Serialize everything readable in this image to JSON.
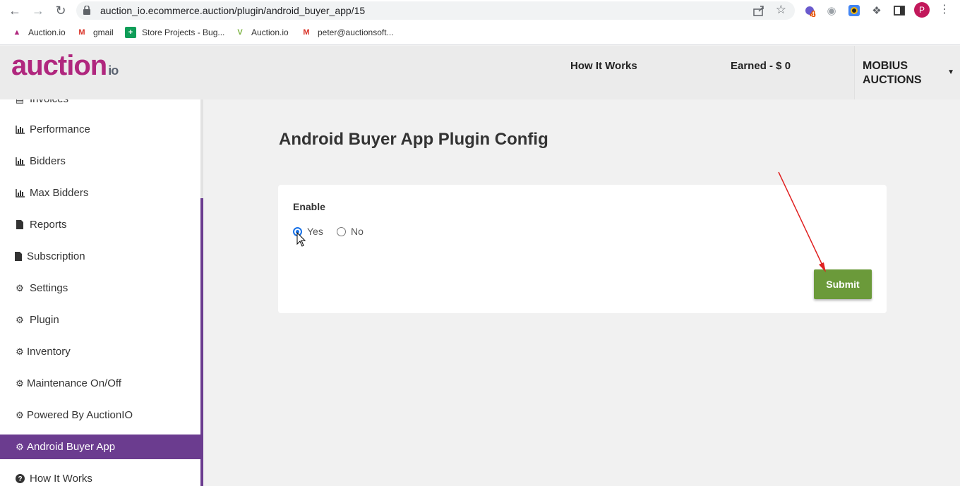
{
  "browser": {
    "url": "auction_io.ecommerce.auction/plugin/android_buyer_app/15",
    "profile_initial": "P",
    "extension_badge": "4"
  },
  "bookmarks": [
    {
      "label": "Auction.io"
    },
    {
      "label": "gmail"
    },
    {
      "label": "Store Projects - Bug..."
    },
    {
      "label": "Auction.io"
    },
    {
      "label": "peter@auctionsoft..."
    }
  ],
  "header": {
    "logo": "auction",
    "logo_suffix": "io",
    "how_it_works": "How It Works",
    "earned": "Earned - $ 0",
    "account_name": "MOBIUS AUCTIONS"
  },
  "sidebar": {
    "items": [
      {
        "label": "Invoices",
        "icon": "list-icon"
      },
      {
        "label": "Performance",
        "icon": "chart-icon"
      },
      {
        "label": "Bidders",
        "icon": "chart-icon"
      },
      {
        "label": "Max Bidders",
        "icon": "chart-icon"
      },
      {
        "label": "Reports",
        "icon": "file-icon"
      },
      {
        "label": "Subscription",
        "icon": "file-icon"
      },
      {
        "label": "Settings",
        "icon": "gear-icon"
      },
      {
        "label": "Plugin",
        "icon": "gear-icon"
      },
      {
        "label": "Inventory",
        "icon": "gear-icon"
      },
      {
        "label": "Maintenance On/Off",
        "icon": "gear-icon"
      },
      {
        "label": "Powered By AuctionIO",
        "icon": "gear-icon"
      },
      {
        "label": "Android Buyer App",
        "icon": "gear-icon",
        "active": true
      },
      {
        "label": "How It Works",
        "icon": "question-icon"
      }
    ]
  },
  "main": {
    "title": "Android Buyer App Plugin Config",
    "enable_label": "Enable",
    "options": [
      {
        "label": "Yes",
        "selected": true
      },
      {
        "label": "No",
        "selected": false
      }
    ],
    "submit_label": "Submit"
  },
  "colors": {
    "brand": "#b0277e",
    "sidebar_active": "#6b3c8f",
    "submit": "#6b9a3a",
    "annotation_arrow": "#e02020"
  }
}
